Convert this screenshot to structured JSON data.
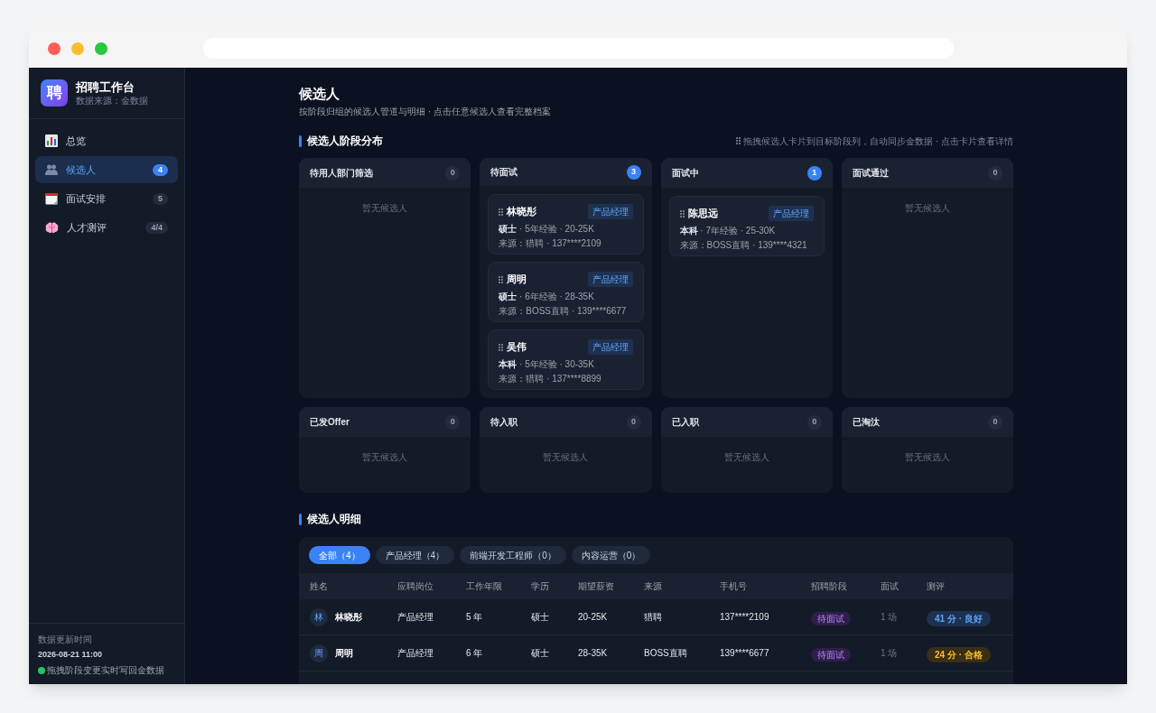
{
  "sidebar": {
    "logo": "聘",
    "title": "招聘工作台",
    "subtitle": "数据来源：金数据",
    "items": [
      {
        "kind": "chart",
        "label": "总览",
        "selected": false
      },
      {
        "kind": "people",
        "label": "候选人",
        "badge": "4",
        "selected": true
      },
      {
        "kind": "calendar",
        "label": "面试安排",
        "badge": "5",
        "selected": false
      },
      {
        "kind": "brain",
        "label": "人才测评",
        "badge": "4/4",
        "selected": false
      }
    ],
    "footer": {
      "label": "数据更新时间",
      "time": "2026-08-21 11:00",
      "status": "拖拽阶段变更实时写回金数据"
    }
  },
  "page": {
    "title": "候选人",
    "subtitle": "按阶段归组的候选人管道与明细 · 点击任意候选人查看完整档案"
  },
  "pipeline": {
    "title": "候选人阶段分布",
    "hint": "拖拽候选人卡片到目标阶段列，自动同步金数据 · 点击卡片查看详情",
    "stages": [
      {
        "name": "待用人部门筛选",
        "count": "0",
        "empty": "暂无候选人"
      },
      {
        "name": "待面试",
        "count": "3",
        "cards": [
          {
            "name": "林晓彤",
            "tag": "产品经理",
            "info": "**硕士** · 5年经验 · 20-25K",
            "source": "来源：猎聘 · 137****2109"
          },
          {
            "name": "周明",
            "tag": "产品经理",
            "info": "**硕士** · 6年经验 · 28-35K",
            "source": "来源：BOSS直聘 · 139****6677"
          },
          {
            "name": "吴伟",
            "tag": "产品经理",
            "info": "**本科** · 5年经验 · 30-35K",
            "source": "来源：猎聘 · 137****8899"
          }
        ]
      },
      {
        "name": "面试中",
        "count": "1",
        "cards": [
          {
            "name": "陈思远",
            "tag": "产品经理",
            "info": "**本科** · 7年经验 · 25-30K",
            "source": "来源：BOSS直聘 · 139****4321"
          }
        ]
      },
      {
        "name": "面试通过",
        "count": "0",
        "empty": "暂无候选人"
      },
      {
        "name": "已发Offer",
        "count": "0",
        "empty": "暂无候选人"
      },
      {
        "name": "待入职",
        "count": "0",
        "empty": "暂无候选人"
      },
      {
        "name": "已入职",
        "count": "0",
        "empty": "暂无候选人"
      },
      {
        "name": "已淘汰",
        "count": "0",
        "empty": "暂无候选人"
      }
    ]
  },
  "details": {
    "title": "候选人明细",
    "filters": [
      {
        "label": "全部（4）",
        "selected": true
      },
      {
        "label": "产品经理（4）",
        "selected": false
      },
      {
        "label": "前端开发工程师（0）",
        "selected": false
      },
      {
        "label": "内容运营（0）",
        "selected": false
      }
    ],
    "table": {
      "columns": [
        "姓名",
        "应聘岗位",
        "工作年限",
        "学历",
        "期望薪资",
        "来源",
        "手机号",
        "招聘阶段",
        "面试",
        "测评"
      ],
      "rows": [
        {
          "avatar": "林",
          "name": "林晓彤",
          "position": "产品经理",
          "years": "5 年",
          "degree": "硕士",
          "salary": "20-25K",
          "source": "猎聘",
          "phone": "137****2109",
          "stage": "待面试",
          "interviews": "1 场",
          "score": {
            "text": "41 分 · 良好",
            "kind": "good"
          }
        },
        {
          "avatar": "周",
          "name": "周明",
          "position": "产品经理",
          "years": "6 年",
          "degree": "硕士",
          "salary": "28-35K",
          "source": "BOSS直聘",
          "phone": "139****6677",
          "stage": "待面试",
          "interviews": "1 场",
          "score": {
            "text": "24 分 · 合格",
            "kind": "pass"
          }
        }
      ]
    }
  }
}
